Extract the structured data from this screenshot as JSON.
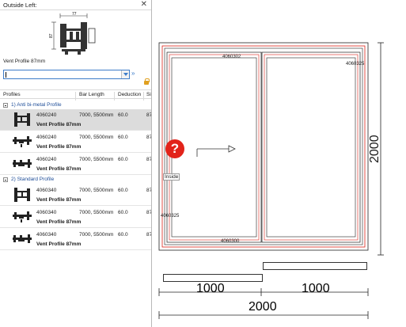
{
  "panel": {
    "title": "Outside Left:",
    "close_glyph": "✕",
    "preview": {
      "dimension_top": "77",
      "dimension_side": "87",
      "caption": "Vent Profile 87mm"
    },
    "search": {
      "value": "",
      "placeholder": ""
    },
    "expand_glyph": "»",
    "columns": [
      "Profiles",
      "Bar Length",
      "Deduction",
      "Si"
    ],
    "groups": [
      {
        "label": "1) Anti bi-metal Profile",
        "rows": [
          {
            "code": "4060240",
            "bar_length": "7000,  5500mm",
            "deduction": "60.0",
            "size": "87",
            "name": "Vent Profile 87mm",
            "selected": true
          },
          {
            "code": "4060240",
            "bar_length": "7000,  5500mm",
            "deduction": "60.0",
            "size": "87",
            "name": "Vent Profile 87mm",
            "selected": false
          },
          {
            "code": "4060240",
            "bar_length": "7000,  5500mm",
            "deduction": "60.0",
            "size": "87",
            "name": "Vent Profile 87mm",
            "selected": false
          }
        ]
      },
      {
        "label": "2) Standard Profile",
        "rows": [
          {
            "code": "4060340",
            "bar_length": "7000,  5500mm",
            "deduction": "60.0",
            "size": "87",
            "name": "Vent Profile 87mm",
            "selected": false
          },
          {
            "code": "4060340",
            "bar_length": "7000,  5500mm",
            "deduction": "60.0",
            "size": "87",
            "name": "Vent Profile 87mm",
            "selected": false
          },
          {
            "code": "4060340",
            "bar_length": "7000,  5500mm",
            "deduction": "60.0",
            "size": "87",
            "name": "Vent Profile 87mm",
            "selected": false
          }
        ]
      }
    ]
  },
  "canvas": {
    "labels": {
      "top_profile": "4060302",
      "right_profile": "4060325",
      "left_profile": "4060325",
      "bottom_profile": "4060300",
      "inside": "Inside",
      "question_mark": "?"
    },
    "dimensions": {
      "height": "2000",
      "left_pane_width": "1000",
      "right_pane_width": "1000",
      "total_width": "2000"
    },
    "colors": {
      "frame_red": "#d9231a",
      "question_red": "#e2231a",
      "accent_blue": "#3d7cc9"
    }
  }
}
